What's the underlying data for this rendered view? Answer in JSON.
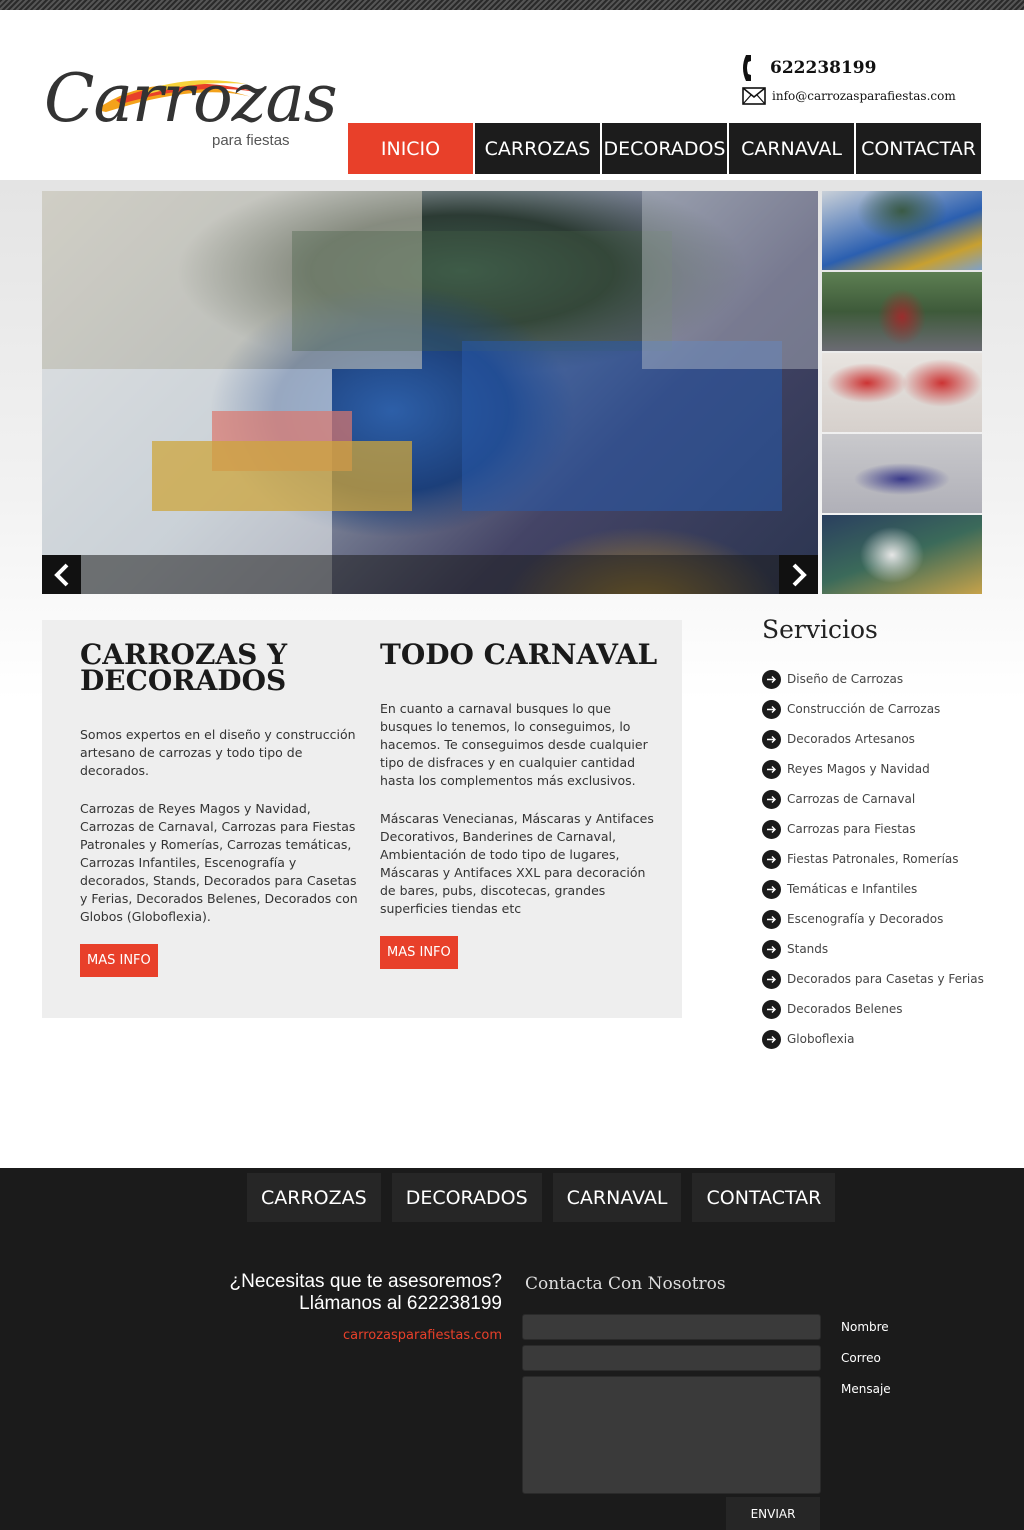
{
  "header": {
    "logo_main": "Carrozas",
    "logo_sub": "para fiestas",
    "phone": "622238199",
    "email": "info@carrozasparafiestas.com"
  },
  "nav": {
    "items": [
      {
        "label": "INICIO",
        "active": true
      },
      {
        "label": "CARROZAS",
        "active": false
      },
      {
        "label": "DECORADOS",
        "active": false
      },
      {
        "label": "CARNAVAL",
        "active": false
      },
      {
        "label": "CONTACTAR",
        "active": false
      }
    ]
  },
  "slider": {
    "prev_icon": "chevron-left-icon",
    "next_icon": "chevron-right-icon",
    "thumbnails": [
      "thumbnail-1",
      "thumbnail-2",
      "thumbnail-3",
      "thumbnail-4",
      "thumbnail-5"
    ]
  },
  "content": {
    "col1": {
      "title": "CARROZAS Y DECORADOS",
      "p1": "Somos expertos en el diseño y construcción artesano de carrozas y todo tipo de decorados.",
      "p2": "Carrozas de Reyes Magos y Navidad, Carrozas de Carnaval, Carrozas para Fiestas Patronales y Romerías, Carrozas temáticas, Carrozas Infantiles, Escenografía y decorados, Stands, Decorados para Casetas y Ferias, Decorados Belenes, Decorados con Globos (Globoflexia).",
      "button": "MAS INFO"
    },
    "col2": {
      "title": "TODO CARNAVAL",
      "p1": "En cuanto a carnaval busques lo que busques lo tenemos, lo conseguimos, lo hacemos. Te conseguimos desde cualquier tipo de disfraces y en cualquier cantidad hasta los complementos más exclusivos.",
      "p2": "Máscaras Venecianas, Máscaras y Antifaces Decorativos, Banderines de Carnaval, Ambientación de todo tipo de lugares, Máscaras y Antifaces XXL para decoración de bares, pubs, discotecas, grandes superficies tiendas etc",
      "button": "MAS INFO"
    }
  },
  "servicios": {
    "title": "Servicios",
    "items": [
      "Diseño de Carrozas",
      "Construcción de Carrozas",
      "Decorados Artesanos",
      "Reyes Magos y Navidad",
      "Carrozas de Carnaval",
      "Carrozas para Fiestas",
      "Fiestas Patronales, Romerías",
      "Temáticas e Infantiles",
      "Escenografía y Decorados",
      "Stands",
      "Decorados para Casetas y Ferias",
      "Decorados Belenes",
      "Globoflexia"
    ]
  },
  "footer": {
    "nav": [
      "CARROZAS",
      "DECORADOS",
      "CARNAVAL",
      "CONTACTAR"
    ],
    "help_line1": "¿Necesitas que te asesoremos?",
    "help_line2": "Llámanos al 622238199",
    "site": "carrozasparafiestas.com",
    "form_title": "Contacta Con Nosotros",
    "labels": {
      "name": "Nombre",
      "email": "Correo",
      "message": "Mensaje"
    },
    "send": "ENVIAR"
  },
  "colors": {
    "accent": "#e8402a",
    "nav_dark": "#1c1c1c",
    "footer_bg": "#1b1b1b"
  }
}
